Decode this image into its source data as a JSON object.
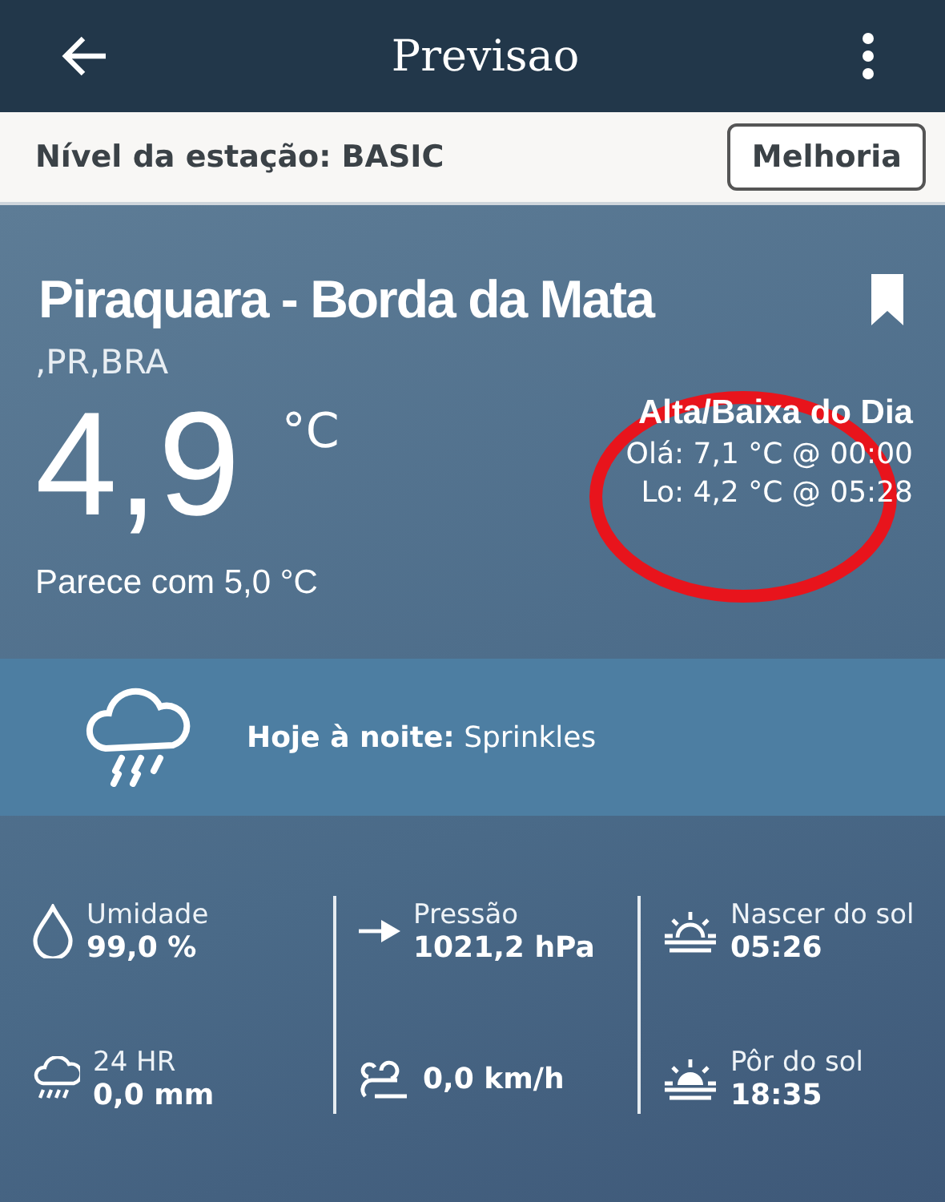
{
  "header": {
    "title": "Previsao"
  },
  "station": {
    "level_text": "Nível da estação: BASIC",
    "upgrade_button": "Melhoria"
  },
  "location": {
    "name": "Piraquara - Borda da Mata",
    "region": ",PR,BRA",
    "bookmarked": true
  },
  "current": {
    "temperature": "4,9",
    "unit": "°C",
    "feels_like": "Parece com 5,0 °C"
  },
  "high_low": {
    "title": "Alta/Baixa do Dia",
    "high": "Olá: 7,1 °C @ 00:00",
    "low": "Lo: 4,2 °C @ 05:28"
  },
  "forecast": {
    "label": "Hoje à noite:",
    "text": "Sprinkles"
  },
  "stats": [
    {
      "kind": "humidity",
      "label": "Umidade",
      "value": "99,0 %"
    },
    {
      "kind": "pressure",
      "label": "Pressão",
      "value": "1021,2 hPa"
    },
    {
      "kind": "sunrise",
      "label": "Nascer do sol",
      "value": "05:26"
    },
    {
      "kind": "rain",
      "label": "24 HR",
      "value": "0,0 mm"
    },
    {
      "kind": "wind",
      "value": "0,0 km/h"
    },
    {
      "kind": "sunset",
      "label": "Pôr do sol",
      "value": "18:35"
    }
  ]
}
